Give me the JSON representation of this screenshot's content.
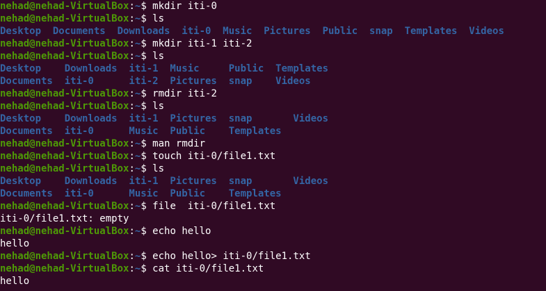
{
  "terminal": {
    "prompt_user": "nehad@nehad-VirtualBox",
    "prompt_colon": ":",
    "prompt_path": "~",
    "prompt_symbol": "$ ",
    "lines": [
      {
        "kind": "cmd",
        "text": "mkdir iti-0"
      },
      {
        "kind": "cmd",
        "text": "ls"
      },
      {
        "kind": "dirs",
        "text": "Desktop  Documents  Downloads  iti-0  Music  Pictures  Public  snap  Templates  Videos"
      },
      {
        "kind": "cmd",
        "text": "mkdir iti-1 iti-2"
      },
      {
        "kind": "cmd",
        "text": "ls"
      },
      {
        "kind": "dirs",
        "text": "Desktop    Downloads  iti-1  Music     Public  Templates"
      },
      {
        "kind": "dirs",
        "text": "Documents  iti-0      iti-2  Pictures  snap    Videos"
      },
      {
        "kind": "cmd",
        "text": "rmdir iti-2"
      },
      {
        "kind": "cmd",
        "text": "ls"
      },
      {
        "kind": "dirs",
        "text": "Desktop    Downloads  iti-1  Pictures  snap       Videos"
      },
      {
        "kind": "dirs",
        "text": "Documents  iti-0      Music  Public    Templates"
      },
      {
        "kind": "cmd",
        "text": "man rmdir"
      },
      {
        "kind": "cmd",
        "text": "touch iti-0/file1.txt"
      },
      {
        "kind": "cmd",
        "text": "ls"
      },
      {
        "kind": "dirs",
        "text": "Desktop    Downloads  iti-1  Pictures  snap       Videos"
      },
      {
        "kind": "dirs",
        "text": "Documents  iti-0      Music  Public    Templates"
      },
      {
        "kind": "cmd",
        "text": "file  iti-0/file1.txt"
      },
      {
        "kind": "out",
        "text": "iti-0/file1.txt: empty"
      },
      {
        "kind": "cmd",
        "text": "echo hello"
      },
      {
        "kind": "out",
        "text": "hello"
      },
      {
        "kind": "cmd",
        "text": "echo hello> iti-0/file1.txt"
      },
      {
        "kind": "cmd",
        "text": "cat iti-0/file1.txt"
      },
      {
        "kind": "out",
        "text": "hello"
      }
    ]
  },
  "colors": {
    "background": "#300a24",
    "prompt_user": "#4e9a06",
    "prompt_path": "#3465a4",
    "directory": "#3465a4",
    "text": "#ffffff"
  }
}
